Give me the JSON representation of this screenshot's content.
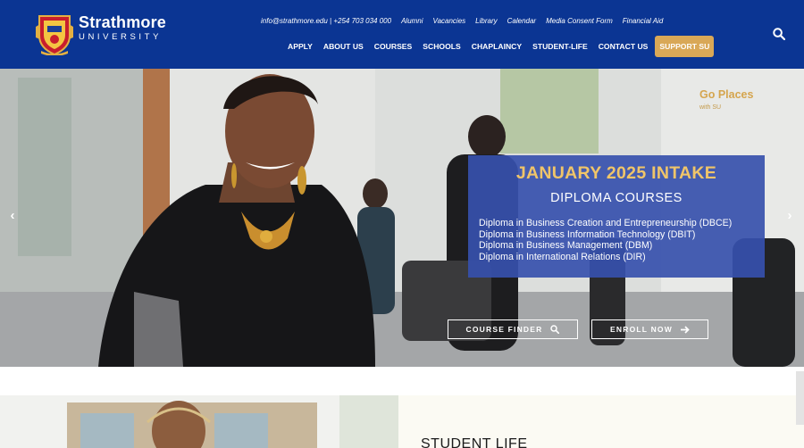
{
  "header": {
    "brand_name": "Strathmore",
    "brand_sub": "UNIVERSITY",
    "contact": "info@strathmore.edu | +254 703 034 000",
    "top_links": [
      "Alumni",
      "Vacancies",
      "Library",
      "Calendar",
      "Media Consent Form",
      "Financial Aid"
    ],
    "nav": [
      "APPLY",
      "ABOUT US",
      "COURSES",
      "SCHOOLS",
      "CHAPLAINCY",
      "STUDENT-LIFE",
      "CONTACT US"
    ],
    "support_label": "SUPPORT SU"
  },
  "hero": {
    "badge_line1": "Go Places",
    "badge_line2": "with SU",
    "intake_title": "JANUARY 2025 INTAKE",
    "intake_subtitle": "DIPLOMA COURSES",
    "courses": [
      "Diploma in Business Creation and Entrepreneurship (DBCE)",
      "Diploma in Business Information Technology (DBIT)",
      "Diploma in Business Management (DBM)",
      "Diploma in International Relations (DIR)"
    ],
    "course_finder_label": "COURSE FINDER",
    "enroll_label": "ENROLL NOW",
    "prev_arrow": "‹",
    "next_arrow": "›"
  },
  "section": {
    "title": "STUDENT LIFE"
  },
  "colors": {
    "header_bg": "#0b3593",
    "accent_gold": "#d9a857",
    "intake_box": "#3650ac",
    "intake_title": "#f0c569"
  }
}
